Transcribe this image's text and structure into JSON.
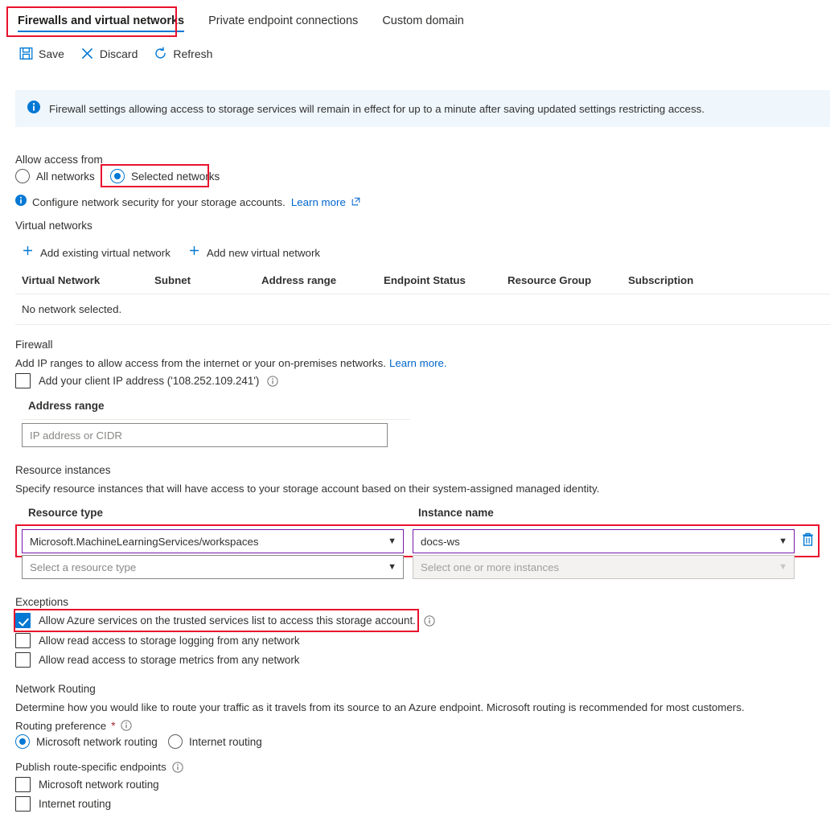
{
  "tabs": [
    {
      "label": "Firewalls and virtual networks",
      "active": true
    },
    {
      "label": "Private endpoint connections",
      "active": false
    },
    {
      "label": "Custom domain",
      "active": false
    }
  ],
  "toolbar": {
    "save_label": "Save",
    "discard_label": "Discard",
    "refresh_label": "Refresh"
  },
  "banner": {
    "icon": "info-icon",
    "text": "Firewall settings allowing access to storage services will remain in effect for up to a minute after saving updated settings restricting access."
  },
  "allow_access": {
    "section_label": "Allow access from",
    "options": [
      {
        "label": "All networks",
        "selected": false
      },
      {
        "label": "Selected networks",
        "selected": true
      }
    ],
    "hint_text": "Configure network security for your storage accounts.",
    "hint_link": "Learn more"
  },
  "virtual_networks": {
    "section_label": "Virtual networks",
    "add_existing_label": "Add existing virtual network",
    "add_new_label": "Add new virtual network",
    "columns": [
      "Virtual Network",
      "Subnet",
      "Address range",
      "Endpoint Status",
      "Resource Group",
      "Subscription"
    ],
    "empty_message": "No network selected."
  },
  "firewall": {
    "section_label": "Firewall",
    "description": "Add IP ranges to allow access from the internet or your on-premises networks.",
    "description_link": "Learn more.",
    "client_ip_label": "Add your client IP address ('108.252.109.241')",
    "client_ip_checked": false,
    "address_range_label": "Address range",
    "address_range_value": "",
    "address_range_placeholder": "IP address or CIDR"
  },
  "resource_instances": {
    "section_label": "Resource instances",
    "description": "Specify resource instances that will have access to your storage account based on their system-assigned managed identity.",
    "col_resource_type": "Resource type",
    "col_instance_name": "Instance name",
    "rows": [
      {
        "resource_type": "Microsoft.MachineLearningServices/workspaces",
        "instance_name": "docs-ws",
        "filled": true,
        "delete_icon": "trash-icon"
      },
      {
        "resource_type_placeholder": "Select a resource type",
        "instance_name_placeholder": "Select one or more instances",
        "filled": false
      }
    ]
  },
  "exceptions": {
    "section_label": "Exceptions",
    "items": [
      {
        "label": "Allow Azure services on the trusted services list to access this storage account.",
        "checked": true,
        "has_info": true
      },
      {
        "label": "Allow read access to storage logging from any network",
        "checked": false,
        "has_info": false
      },
      {
        "label": "Allow read access to storage metrics from any network",
        "checked": false,
        "has_info": false
      }
    ]
  },
  "network_routing": {
    "section_label": "Network Routing",
    "description": "Determine how you would like to route your traffic as it travels from its source to an Azure endpoint. Microsoft routing is recommended for most customers.",
    "routing_preference_label": "Routing preference",
    "required_marker": "*",
    "routing_options": [
      {
        "label": "Microsoft network routing",
        "selected": true
      },
      {
        "label": "Internet routing",
        "selected": false
      }
    ],
    "publish_label": "Publish route-specific endpoints",
    "publish_options": [
      {
        "label": "Microsoft network routing",
        "checked": false
      },
      {
        "label": "Internet routing",
        "checked": false
      }
    ]
  },
  "colors": {
    "accent": "#0078d4",
    "annotation": "#e8112d",
    "focus_border": "#7719aa",
    "banner_bg": "#eff6fc",
    "link": "#0066cc"
  }
}
